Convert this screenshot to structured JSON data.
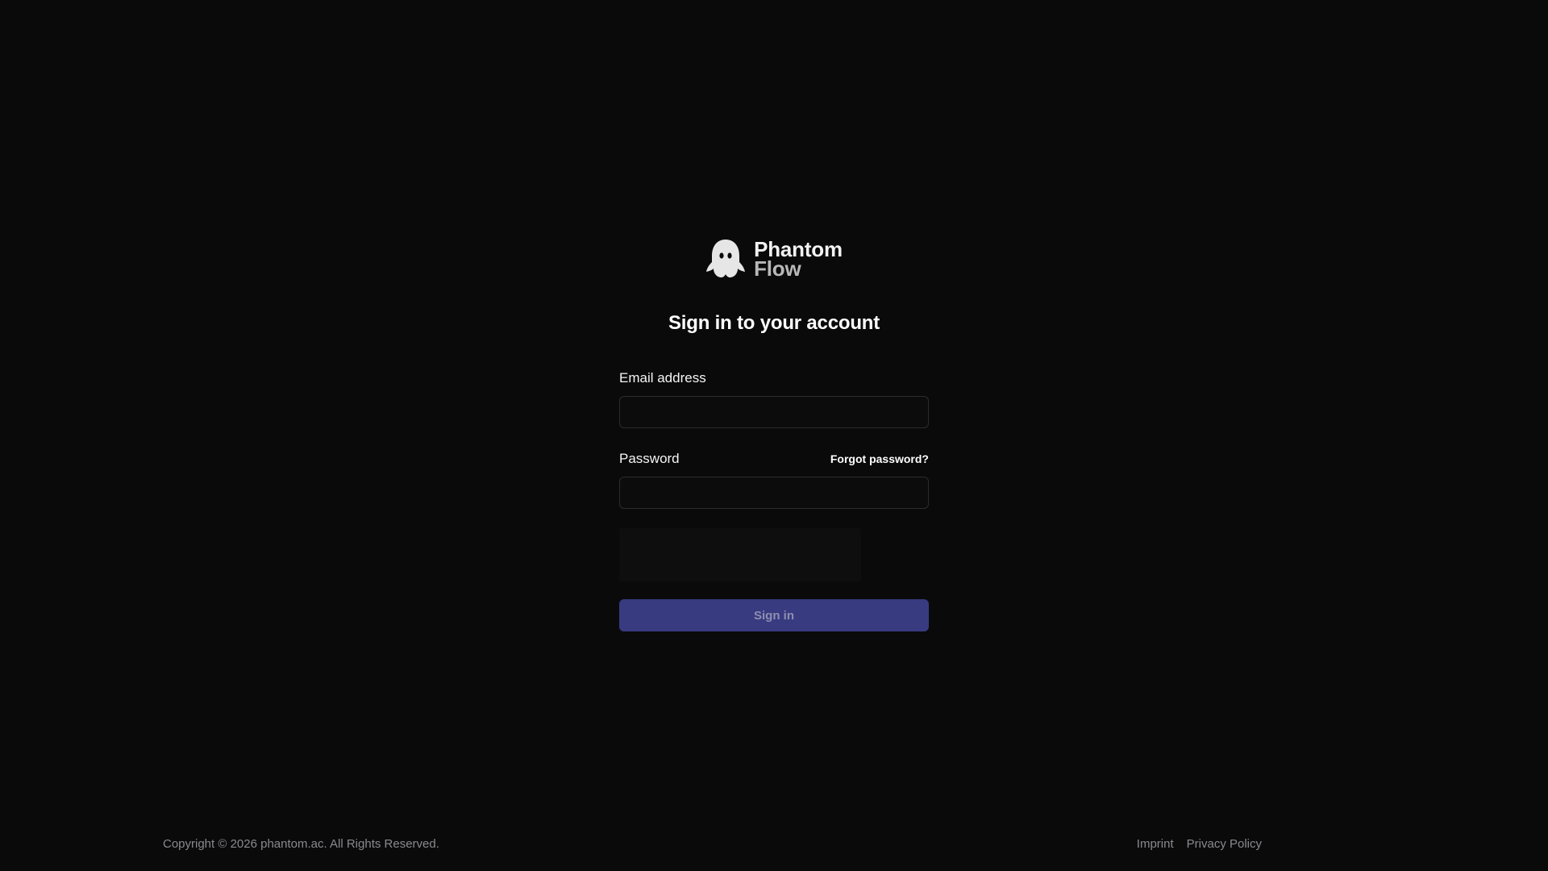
{
  "brand": {
    "name_line1": "Phantom",
    "name_line2": "Flow",
    "logo_icon": "ghost-icon"
  },
  "auth": {
    "title": "Sign in to your account",
    "email": {
      "label": "Email address",
      "value": "",
      "placeholder": ""
    },
    "password": {
      "label": "Password",
      "value": "",
      "placeholder": "",
      "forgot_label": "Forgot password?"
    },
    "submit_label": "Sign in"
  },
  "footer": {
    "copyright": "Copyright © 2026 phantom.ac. All Rights Reserved.",
    "links": [
      {
        "label": "Imprint"
      },
      {
        "label": "Privacy Policy"
      }
    ]
  },
  "colors": {
    "background": "#0a0a0b",
    "accent": "#383b80",
    "muted_text": "#8a8a8e"
  }
}
